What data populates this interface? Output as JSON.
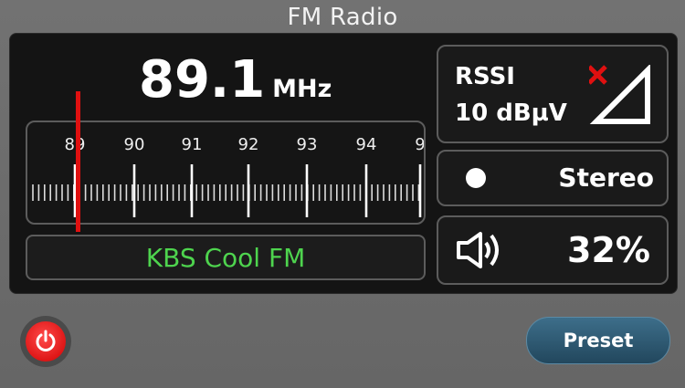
{
  "app": {
    "title": "FM Radio"
  },
  "tuner": {
    "frequency": "89.1",
    "unit": "MHz",
    "scale_labels": [
      "89",
      "90",
      "91",
      "92",
      "93",
      "94",
      "9"
    ],
    "station_name": "KBS Cool FM",
    "needle_color": "#e01010",
    "station_color": "#4ed44e"
  },
  "rssi": {
    "label": "RSSI",
    "value": "10 dBµV",
    "icon": "signal-triangle-icon",
    "status_icon": "close-icon"
  },
  "stereo": {
    "label": "Stereo",
    "icon": "dot-indicator"
  },
  "volume": {
    "value": "32%",
    "icon": "speaker-icon"
  },
  "buttons": {
    "preset": "Preset",
    "power_icon": "power-icon"
  },
  "colors": {
    "accent_red": "#e01010",
    "preset_blue": "#2f5a73",
    "panel_bg": "#141414"
  }
}
